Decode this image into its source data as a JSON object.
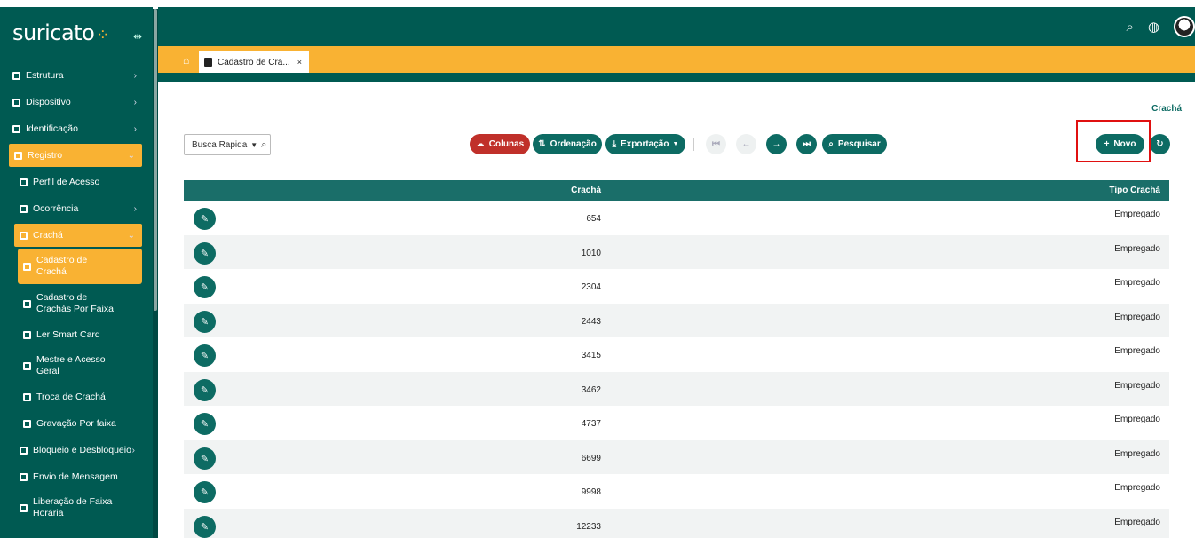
{
  "app": {
    "logo": "suricato",
    "logo_dots": "⁘"
  },
  "sidebar": {
    "items": [
      {
        "label": "Estrutura",
        "icon": "building-icon",
        "chevron": "›"
      },
      {
        "label": "Dispositivo",
        "icon": "device-icon",
        "chevron": "›"
      },
      {
        "label": "Identificação",
        "icon": "id-card-icon",
        "chevron": "›"
      },
      {
        "label": "Registro",
        "icon": "register-icon",
        "chevron": "⌄"
      },
      {
        "label": "Perfil de Acesso",
        "icon": "doc-icon"
      },
      {
        "label": "Ocorrência",
        "icon": "doc-icon",
        "chevron": "›"
      },
      {
        "label": "Crachá",
        "icon": "doc-icon",
        "chevron": "⌄"
      },
      {
        "label_l1": "Cadastro de",
        "label_l2": "Crachá",
        "icon": "doc-icon"
      },
      {
        "label_l1": "Cadastro de",
        "label_l2": "Crachás Por Faixa",
        "icon": "doc-icon"
      },
      {
        "label": "Ler Smart Card",
        "icon": "doc-icon"
      },
      {
        "label_l1": "Mestre e Acesso",
        "label_l2": "Geral",
        "icon": "doc-icon"
      },
      {
        "label": "Troca de Crachá",
        "icon": "doc-icon"
      },
      {
        "label": "Gravação Por faixa",
        "icon": "doc-icon"
      },
      {
        "label": "Bloqueio e Desbloqueio",
        "icon": "doc-icon",
        "chevron": "›"
      },
      {
        "label": "Envio de Mensagem",
        "icon": "doc-icon"
      },
      {
        "label_l1": "Liberação de Faixa",
        "label_l2": "Horária",
        "icon": "doc-icon"
      }
    ]
  },
  "topbar": {
    "icons": [
      "search-icon",
      "globe-icon",
      "avatar"
    ]
  },
  "tabs": {
    "home_icon": "home-icon",
    "active_tab": "Cadastro de Cra...",
    "close": "×"
  },
  "page": {
    "breadcrumb_current": "Crachá"
  },
  "toolbar": {
    "quick_search": "Busca Rapida",
    "columns": "Colunas",
    "ordering": "Ordenação",
    "export": "Exportação",
    "search": "Pesquisar",
    "new": "Novo"
  },
  "table": {
    "headers": [
      "Crachá",
      "Tipo Crachá"
    ],
    "rows": [
      {
        "cracha": "654",
        "tipo": "Empregado"
      },
      {
        "cracha": "1010",
        "tipo": "Empregado"
      },
      {
        "cracha": "2304",
        "tipo": "Empregado"
      },
      {
        "cracha": "2443",
        "tipo": "Empregado"
      },
      {
        "cracha": "3415",
        "tipo": "Empregado"
      },
      {
        "cracha": "3462",
        "tipo": "Empregado"
      },
      {
        "cracha": "4737",
        "tipo": "Empregado"
      },
      {
        "cracha": "6699",
        "tipo": "Empregado"
      },
      {
        "cracha": "9998",
        "tipo": "Empregado"
      },
      {
        "cracha": "12233",
        "tipo": "Empregado"
      }
    ]
  },
  "colors": {
    "primary": "#005a52",
    "accent": "#f9b233",
    "danger": "#c0302a",
    "highlight_box": "#e01010"
  }
}
